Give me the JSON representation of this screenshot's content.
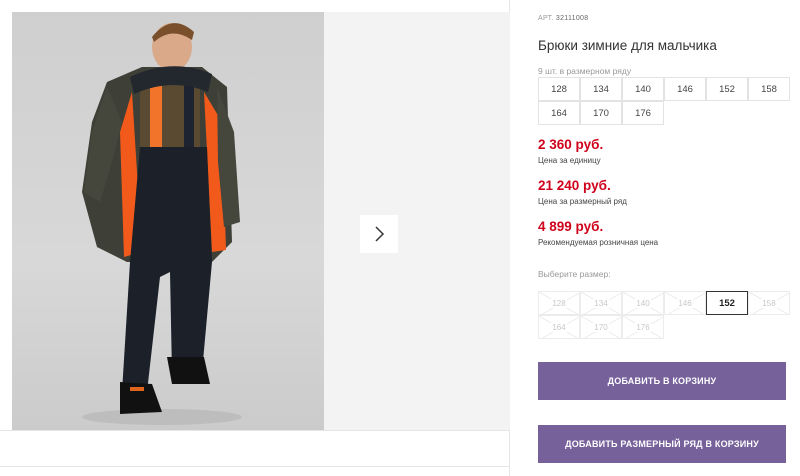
{
  "product": {
    "article_label": "АРТ.",
    "article_number": "32111008",
    "title": "Брюки зимние для мальчика",
    "size_count": "9 шт. в размерном ряду",
    "sizes": [
      "128",
      "134",
      "140",
      "146",
      "152",
      "158",
      "164",
      "170",
      "176"
    ]
  },
  "prices": {
    "unit_price": "2 360 руб.",
    "unit_label": "Цена за единицу",
    "pack_price": "21 240 руб.",
    "pack_label": "Цена за размерный ряд",
    "retail_price": "4 899 руб.",
    "retail_label": "Рекомендуемая розничная цена"
  },
  "size_select": {
    "label": "Выберите размер:",
    "options": [
      "128",
      "134",
      "140",
      "146",
      "152",
      "158",
      "164",
      "170",
      "176"
    ],
    "selected": "152"
  },
  "buttons": {
    "add_to_cart": "ДОБАВИТЬ В КОРЗИНУ",
    "add_pack_to_cart": "ДОБАВИТЬ РАЗМЕРНЫЙ РЯД В КОРЗИНУ"
  },
  "gallery": {
    "next_icon": "chevron-right-icon"
  },
  "colors": {
    "price": "#d0021b",
    "button": "#76619b"
  }
}
